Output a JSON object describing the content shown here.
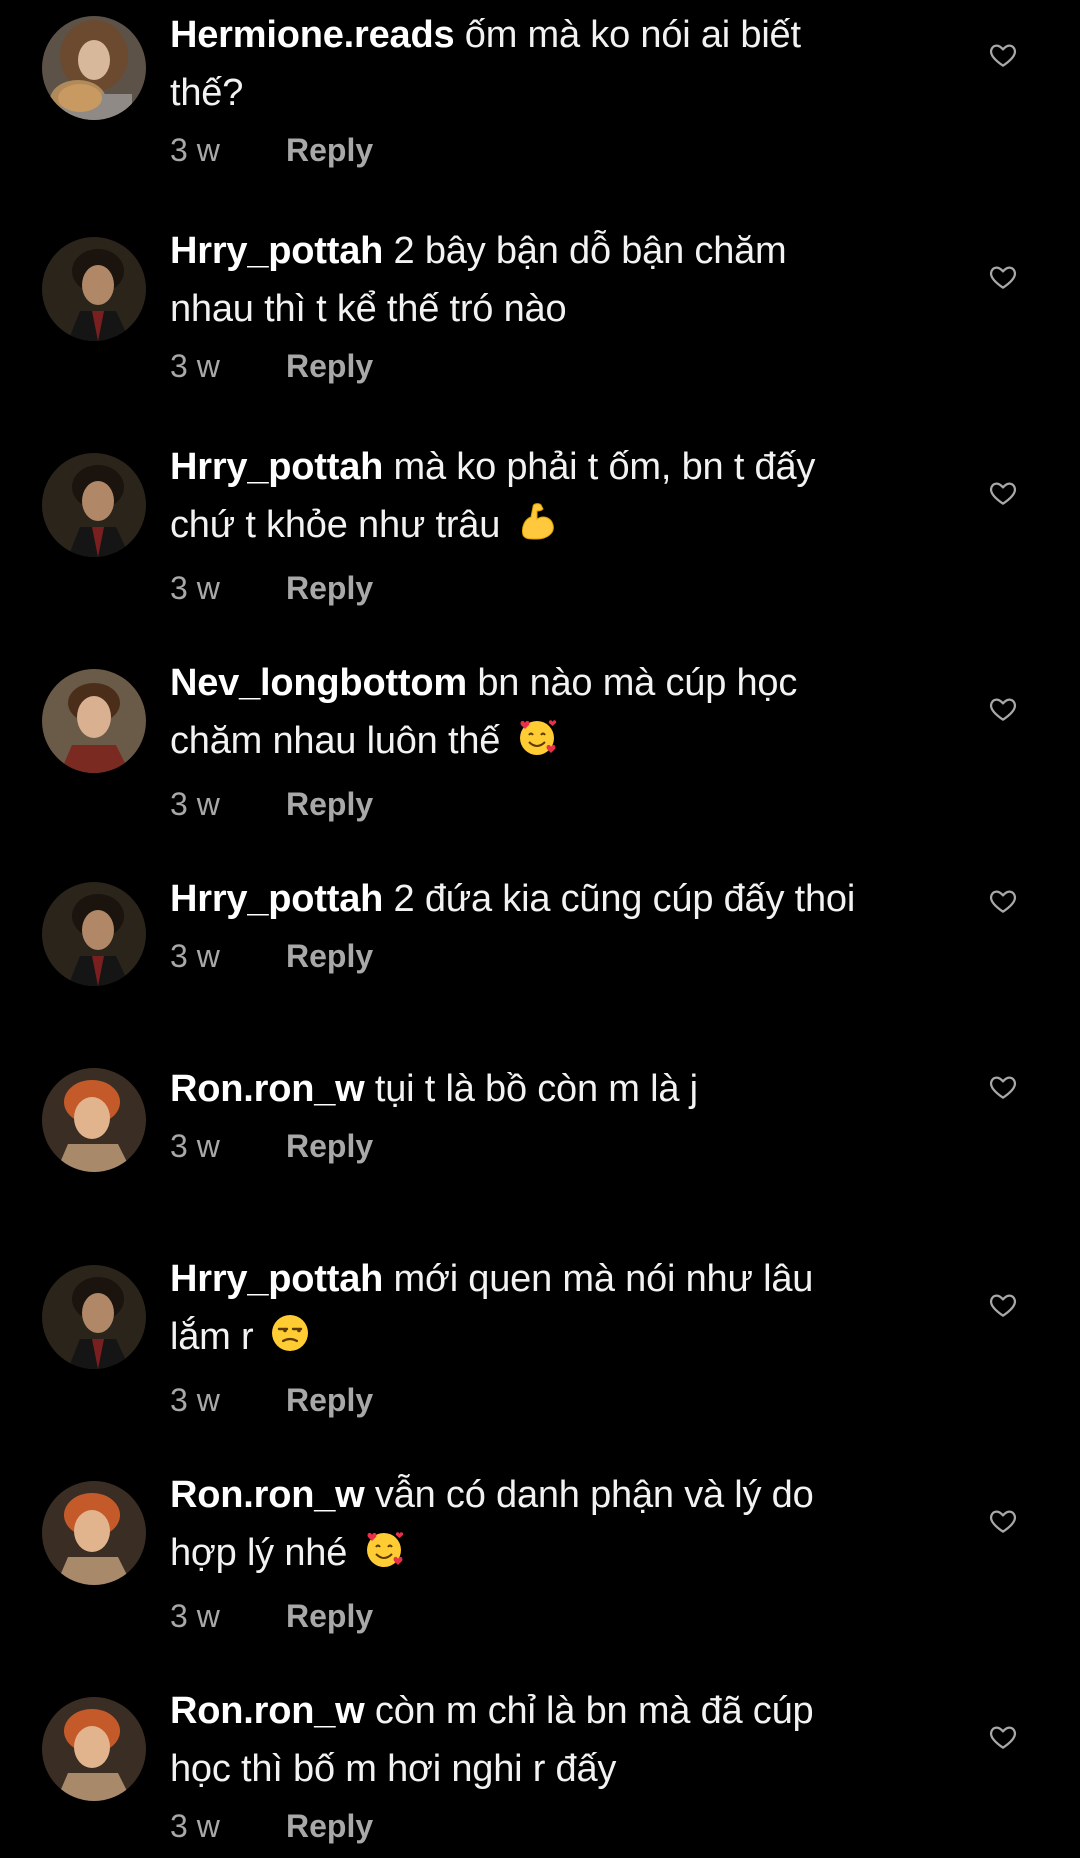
{
  "comments": [
    {
      "username": "Hermione.reads",
      "text": "ốm mà ko nói ai biết",
      "text_line2": "thế?",
      "emoji": "",
      "time": "3 w",
      "reply": "Reply",
      "avatar": "hermione"
    },
    {
      "username": "Hrry_pottah",
      "text": "2 bây bận dỗ bận chăm",
      "text_line2": "nhau thì t kể thế tró nào",
      "emoji": "",
      "time": "3 w",
      "reply": "Reply",
      "avatar": "harry"
    },
    {
      "username": "Hrry_pottah",
      "text": "mà ko phải t ốm, bn t đấy",
      "text_line2": "chứ t khỏe như trâu",
      "emoji": "flexed-biceps",
      "time": "3 w",
      "reply": "Reply",
      "avatar": "harry"
    },
    {
      "username": "Nev_longbottom",
      "text": "bn nào mà cúp học",
      "text_line2": "chăm nhau luôn thế",
      "emoji": "smiling-face-with-hearts",
      "time": "3 w",
      "reply": "Reply",
      "avatar": "neville"
    },
    {
      "username": "Hrry_pottah",
      "text": "2 đứa kia cũng cúp đấy thoi",
      "text_line2": "",
      "emoji": "",
      "time": "3 w",
      "reply": "Reply",
      "avatar": "harry"
    },
    {
      "username": "Ron.ron_w",
      "text": "tụi t là bồ còn m là j",
      "text_line2": "",
      "emoji": "",
      "time": "3 w",
      "reply": "Reply",
      "avatar": "ron"
    },
    {
      "username": "Hrry_pottah",
      "text": "mới quen mà nói như lâu",
      "text_line2": "lắm r",
      "emoji": "unamused-face",
      "time": "3 w",
      "reply": "Reply",
      "avatar": "harry"
    },
    {
      "username": "Ron.ron_w",
      "text": "vẫn có danh phận và lý do",
      "text_line2": "hợp lý nhé",
      "emoji": "smiling-face-with-hearts",
      "time": "3 w",
      "reply": "Reply",
      "avatar": "ron"
    },
    {
      "username": "Ron.ron_w",
      "text": "còn m chỉ là bn mà đã cúp",
      "text_line2": "học thì bố m hơi nghi r đấy",
      "emoji": "",
      "time": "3 w",
      "reply": "Reply",
      "avatar": "ron"
    }
  ],
  "like_icon": "heart-outline-icon",
  "colors": {
    "background": "#000000",
    "text": "#f2f2f2",
    "meta": "#a8a8a8"
  }
}
